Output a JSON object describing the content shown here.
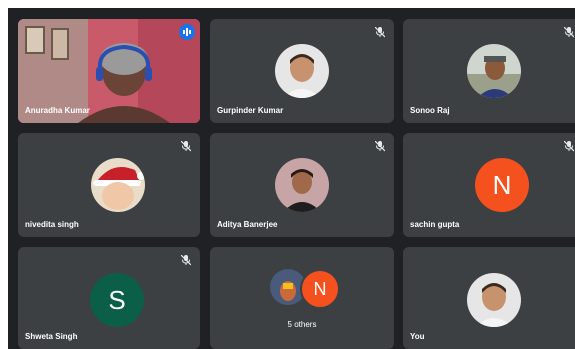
{
  "participants": [
    {
      "name": "Anuradha Kumar",
      "muted": false,
      "speaking": true,
      "tile": "video"
    },
    {
      "name": "Gurpinder Kumar",
      "muted": true,
      "tile": "avatar-photo"
    },
    {
      "name": "Sonoo Raj",
      "muted": true,
      "tile": "avatar-photo"
    },
    {
      "name": "nivedita singh",
      "muted": true,
      "tile": "avatar-photo"
    },
    {
      "name": "Aditya Banerjee",
      "muted": true,
      "tile": "avatar-photo"
    },
    {
      "name": "sachin gupta",
      "muted": true,
      "tile": "avatar-letter",
      "initial": "N",
      "color": "#f4511e"
    },
    {
      "name": "Shweta Singh",
      "muted": true,
      "tile": "avatar-letter",
      "initial": "S",
      "color": "#0b5e47"
    },
    {
      "name": "5 others",
      "tile": "others",
      "initial": "N",
      "color": "#f4511e"
    },
    {
      "name": "You",
      "muted": false,
      "tile": "avatar-photo"
    }
  ],
  "colors": {
    "background": "#202124",
    "tile": "#3c4043",
    "accent": "#1a73e8",
    "active_outline": "#8ab4f8"
  },
  "icons": {
    "muted": "mic-off-icon",
    "speaking": "audio-wave-icon"
  }
}
